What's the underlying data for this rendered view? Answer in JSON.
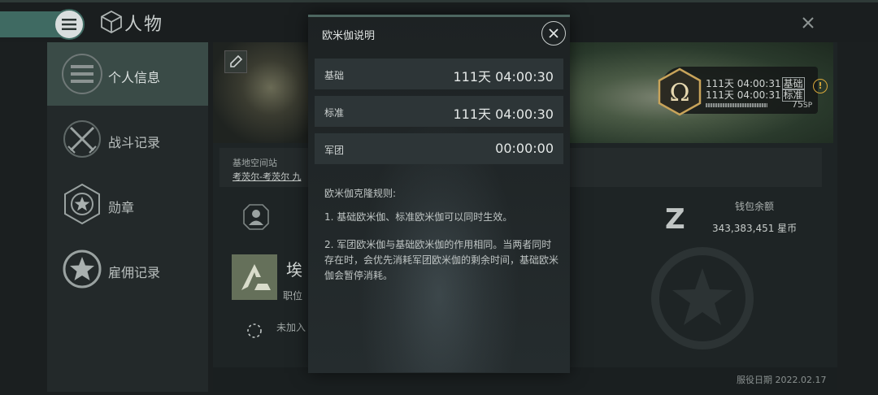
{
  "header": {
    "title": "人物",
    "menu_icon": "menu-icon",
    "character_icon": "character-icon",
    "close_icon": "close-icon"
  },
  "sidebar": {
    "items": [
      {
        "label": "个人信息",
        "icon": "list-icon",
        "selected": true
      },
      {
        "label": "战斗记录",
        "icon": "crossed-swords-icon",
        "selected": false
      },
      {
        "label": "勋章",
        "icon": "star-medal-icon",
        "selected": false
      },
      {
        "label": "雇佣记录",
        "icon": "star-badge-icon",
        "selected": false
      }
    ]
  },
  "profile": {
    "station_label": "基地空间站",
    "station_name": "考茨尔-考茨尔 九",
    "wallet_label": "钱包余额",
    "wallet_value": "343,383,451 星币",
    "corp_name": "埃",
    "position_label": "职位",
    "join_label": "未加入",
    "service_date": "服役日期 2022.02.17"
  },
  "omega_status": {
    "line1_time": "111天 04:00:31",
    "line1_tag": "基础",
    "line2_time": "111天 04:00:31",
    "line2_tag": "标准",
    "sp": "75",
    "sp_unit": "SP",
    "warn": "!"
  },
  "modal": {
    "title": "欧米伽说明",
    "rows": [
      {
        "label": "基础",
        "value": "111天 04:00:30"
      },
      {
        "label": "标准",
        "value": "111天 04:00:30"
      },
      {
        "label": "军团",
        "value": "00:00:00"
      }
    ],
    "rules_title": "欧米伽克隆规则:",
    "rules": [
      "1. 基础欧米伽、标准欧米伽可以同时生效。",
      "2. 军团欧米伽与基础欧米伽的作用相同。当两者同时存在时，会优先消耗军团欧米伽的剩余时间，基础欧米伽会暂停消耗。"
    ]
  },
  "colors": {
    "accent": "#3f6a62",
    "selected_item": "#3a4b47",
    "modal_bg": "#1d2223",
    "warning": "#d9a83a"
  }
}
